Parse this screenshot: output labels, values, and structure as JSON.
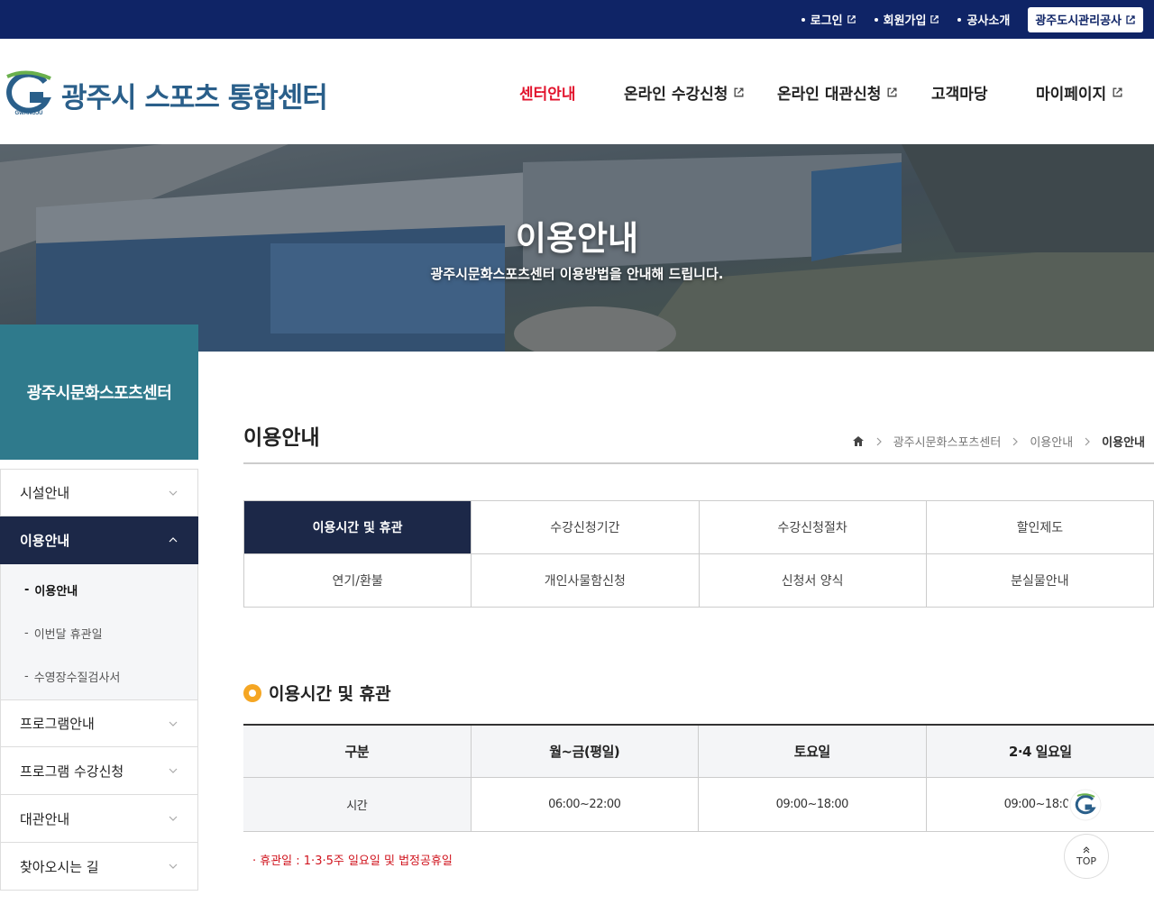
{
  "topbar": {
    "login": "로그인",
    "signup": "회원가입",
    "about": "공사소개",
    "corp": "광주도시관리공사"
  },
  "header": {
    "title": "광주시 스포츠 통합센터",
    "logo_text": "GWANGJU",
    "gnb": [
      "센터안내",
      "온라인 수강신청",
      "온라인 대관신청",
      "고객마당",
      "마이페이지"
    ]
  },
  "hero": {
    "title": "이용안내",
    "subtitle": "광주시문화스포츠센터 이용방법을 안내해 드립니다."
  },
  "sidebar": {
    "heading": "광주시문화스포츠센터",
    "items": [
      "시설안내",
      "이용안내",
      "프로그램안내",
      "프로그램 수강신청",
      "대관안내",
      "찾아오시는 길"
    ],
    "sub_items": [
      "이용안내",
      "이번달 휴관일",
      "수영장수질검사서"
    ]
  },
  "content": {
    "page_title": "이용안내",
    "breadcrumb": [
      "광주시문화스포츠센터",
      "이용안내",
      "이용안내"
    ],
    "tabs": [
      "이용시간 및 휴관",
      "수강신청기간",
      "수강신청절차",
      "할인제도",
      "연기/환불",
      "개인사물함신청",
      "신청서 양식",
      "분실물안내"
    ],
    "section_title": "이용시간 및 휴관",
    "table": {
      "headers": [
        "구분",
        "월~금(평일)",
        "토요일",
        "2·4 일요일"
      ],
      "rows": [
        [
          "시간",
          "06:00~22:00",
          "09:00~18:00",
          "09:00~18:00"
        ]
      ]
    },
    "note": "· 휴관일 : 1·3·5주 일요일 및 법정공휴일"
  },
  "float": {
    "top_label": "TOP"
  },
  "colors": {
    "navy": "#0f2466",
    "teal": "#2f7a8c",
    "active_red": "#e2142d",
    "tab_on": "#1c2848",
    "bullet": "#f5a623"
  }
}
